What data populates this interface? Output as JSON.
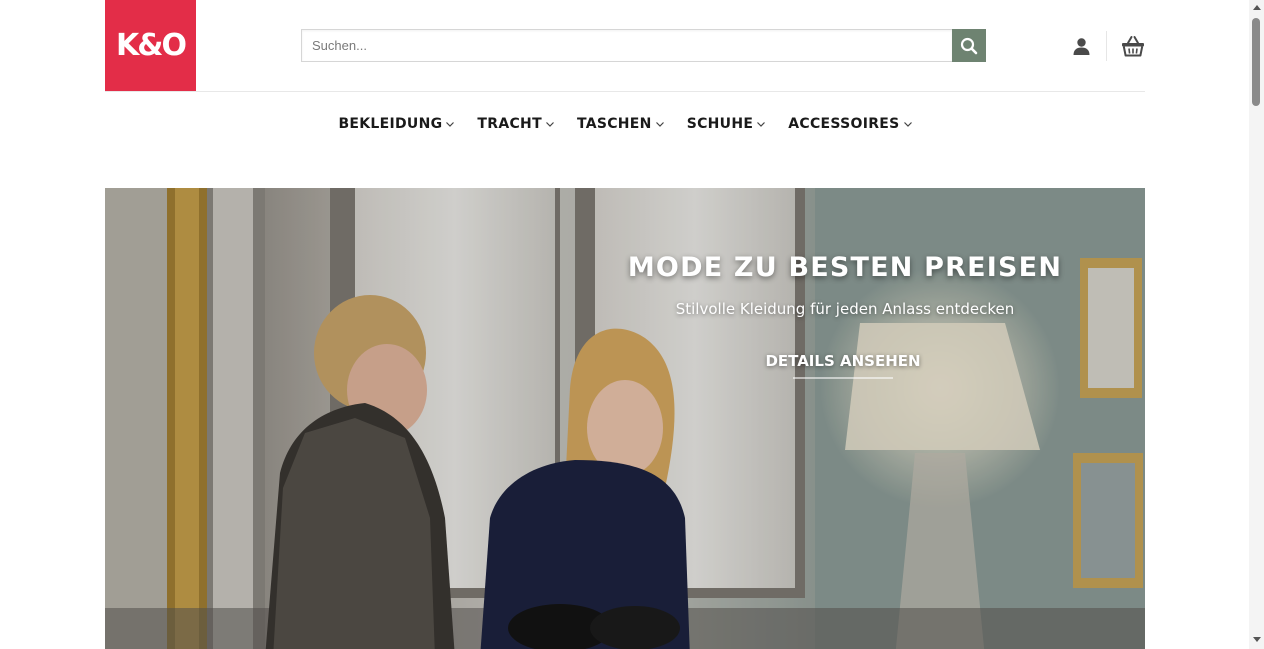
{
  "brand": {
    "logo_text": "K&O",
    "logo_color": "#e32d48"
  },
  "header": {
    "search": {
      "placeholder": "Suchen...",
      "value": ""
    },
    "icons": {
      "search": "search-icon",
      "account": "user-icon",
      "cart": "basket-icon"
    }
  },
  "nav": {
    "items": [
      {
        "label": "BEKLEIDUNG"
      },
      {
        "label": "TRACHT"
      },
      {
        "label": "TASCHEN"
      },
      {
        "label": "SCHUHE"
      },
      {
        "label": "ACCESSOIRES"
      }
    ]
  },
  "hero": {
    "title": "MODE ZU BESTEN PREISEN",
    "subtitle": "Stilvolle Kleidung für jeden Anlass entdecken",
    "cta": "DETAILS ANSEHEN"
  },
  "colors": {
    "accent": "#e32d48",
    "search_button": "#6e8371",
    "text": "#1a1a1a"
  }
}
